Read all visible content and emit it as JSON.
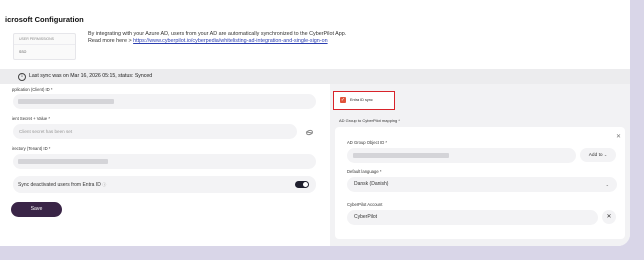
{
  "header": {
    "title": "icrosoft Configuration"
  },
  "side_panel": {
    "items": [
      "USER PERMISSIONS",
      "SSO"
    ]
  },
  "intro": {
    "line1": "By integrating with your Azure AD, users from your AD are automatically synchronized to the CyberPilot App.",
    "line2_prefix": "Read more here > ",
    "link": "https://www.cyberpilot.io/cyberpedia/whitelisting-ad-integration-and-single-sign-on"
  },
  "sync_status": {
    "icon": "info-icon",
    "text": "Last sync was on Mar 16, 2026 05:15, status: Synced"
  },
  "form": {
    "application_id_label": "pplication (Client) ID *",
    "client_secret_label": "ient Secret + Value *",
    "client_secret_placeholder": "Client secret has been set",
    "directory_id_label": "irectory (Tenant) ID *",
    "sync_deactivated_label": "Sync deactivated users from Entra ID",
    "sync_deactivated_on": true,
    "save_label": "Save"
  },
  "mapping": {
    "entra_sync_label": "Entra ID sync",
    "entra_sync_checked": true,
    "mapping_label": "AD Group to CyberPilot mapping *",
    "group_object_id_label": "AD Group Object ID *",
    "add_to_label": "Add to",
    "default_language_label": "Default language *",
    "default_language_value": "Dansk (Danish)",
    "account_label": "CyberPilot Account",
    "account_value": "CyberPilot"
  },
  "colors": {
    "primary_button": "#3a2547",
    "checkbox": "#e0533a",
    "highlight_border": "#d8232a",
    "link": "#2c3fb1"
  }
}
